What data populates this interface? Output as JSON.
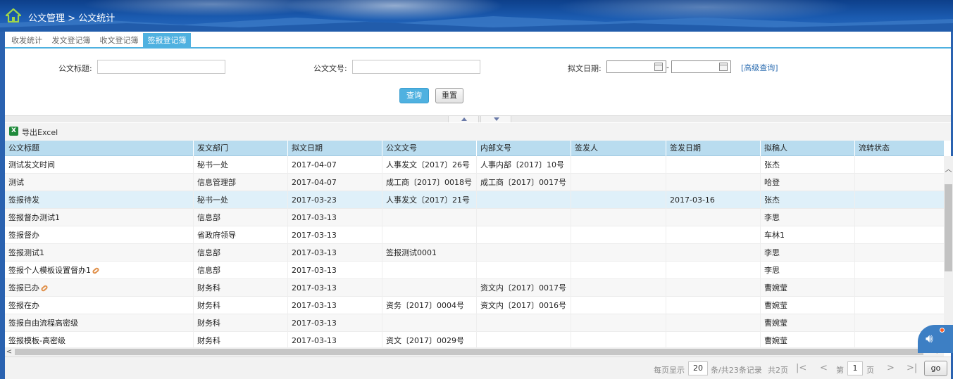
{
  "breadcrumb": {
    "module": "公文管理",
    "separator": ">",
    "page": "公文统计"
  },
  "tabs": [
    {
      "label": "收发统计"
    },
    {
      "label": "发文登记簿"
    },
    {
      "label": "收文登记簿"
    },
    {
      "label": "签报登记簿",
      "active": true
    }
  ],
  "search": {
    "title_label": "公文标题:",
    "title_value": "",
    "docno_label": "公文文号:",
    "docno_value": "",
    "date_label": "拟文日期:",
    "date_from": "",
    "date_sep": "-",
    "date_to": "",
    "advanced_link": "[高级查询]",
    "query_button": "查询",
    "reset_button": "重置"
  },
  "toolbar": {
    "export_label": "导出Excel",
    "export_icon": "excel-icon"
  },
  "grid": {
    "columns": [
      "公文标题",
      "发文部门",
      "拟文日期",
      "公文文号",
      "内部文号",
      "签发人",
      "签发日期",
      "拟稿人",
      "流转状态"
    ],
    "rows": [
      [
        "测试发文时间",
        "秘书一处",
        "2017-04-07",
        "人事发文〔2017〕26号",
        "人事内部〔2017〕10号",
        "",
        "",
        "张杰",
        ""
      ],
      [
        "测试",
        "信息管理部",
        "2017-04-07",
        "成工商〔2017〕0018号",
        "成工商〔2017〕0017号",
        "",
        "",
        "哈登",
        ""
      ],
      [
        "签报待发",
        "秘书一处",
        "2017-03-23",
        "人事发文〔2017〕21号",
        "",
        "",
        "2017-03-16",
        "张杰",
        ""
      ],
      [
        "签报督办测试1",
        "信息部",
        "2017-03-13",
        "",
        "",
        "",
        "",
        "李思",
        ""
      ],
      [
        "签报督办",
        "省政府领导",
        "2017-03-13",
        "",
        "",
        "",
        "",
        "车林1",
        ""
      ],
      [
        "签报测试1",
        "信息部",
        "2017-03-13",
        "签报测试0001",
        "",
        "",
        "",
        "李思",
        ""
      ],
      [
        "签报个人模板设置督办1",
        "信息部",
        "2017-03-13",
        "",
        "",
        "",
        "",
        "李思",
        ""
      ],
      [
        "签报已办",
        "财务科",
        "2017-03-13",
        "",
        "资文内〔2017〕0017号",
        "",
        "",
        "曹婉莹",
        ""
      ],
      [
        "签报在办",
        "财务科",
        "2017-03-13",
        "资务〔2017〕0004号",
        "资文内〔2017〕0016号",
        "",
        "",
        "曹婉莹",
        ""
      ],
      [
        "签报自由流程高密级",
        "财务科",
        "2017-03-13",
        "",
        "",
        "",
        "",
        "曹婉莹",
        ""
      ],
      [
        "签报模板-高密级",
        "财务科",
        "2017-03-13",
        "资文〔2017〕0029号",
        "",
        "",
        "",
        "曹婉莹",
        ""
      ]
    ],
    "attachment_rows": [
      6,
      7
    ],
    "selected_row": 2
  },
  "pager": {
    "per_page_label": "每页显示",
    "per_page": "20",
    "summary": "条/共23条记录",
    "total_pages": "共2页",
    "page_label_before": "第",
    "current_page": "1",
    "page_label_after": "页",
    "go_label": "go"
  },
  "colors": {
    "accent": "#4fb1e0",
    "header_bg": "#b9dcef",
    "banner": "#1b5bb0"
  }
}
